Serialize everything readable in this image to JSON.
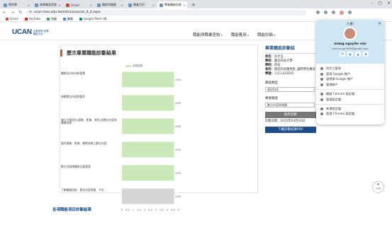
{
  "browser": {
    "tabs": [
      {
        "label": "學習單",
        "active": false
      },
      {
        "label": "搜尋職涯評量",
        "active": false
      },
      {
        "label": "Gmail",
        "active": false
      },
      {
        "label": "職群與職業",
        "active": false
      },
      {
        "label": "職業百科",
        "active": false
      },
      {
        "label": "專業職能診斷",
        "active": true
      }
    ],
    "url": "ucan.moe.edu.tw/mt/ucan/ucan_4_4.aspx",
    "bookmarks": [
      "Gmail",
      "YouTube",
      "地圖",
      "翻譯",
      "Google Meet (視..."
    ]
  },
  "site": {
    "logo": "UCAN",
    "logo_sub": "大專校院 就業職能平台",
    "nav": [
      "職能與職業查詢",
      "職能應用",
      "職能診斷"
    ]
  },
  "main": {
    "card_title": "歷次專業職能診斷結果",
    "legend": "診斷結果",
    "chart_data": {
      "type": "bar",
      "orientation": "horizontal",
      "categories": [
        "職能及分析技術要素",
        "規劃數位內容與製作",
        "進行方案設計(圖像、影像、視訊)及數位內容與基礎技術",
        "製作圖像、影像、動態效果之數位內容",
        "數位內容傳播與品質管理",
        "了解職務技術、數位內容專業、平台"
      ],
      "values": [
        4.6,
        4.6,
        4.6,
        4.6,
        4.6,
        4.6
      ],
      "value_labels": [
        "4.60",
        "4.60",
        "4.60",
        "4.60",
        "4.60",
        "4.60"
      ],
      "xlim": [
        0,
        5
      ],
      "xticks": [
        "0",
        "0.5",
        "1",
        "1.5",
        "2",
        "2.5",
        "3",
        "3.5",
        "4",
        "4.5",
        "5"
      ],
      "colors": [
        "#cbe8b8",
        "#cbe8b8",
        "#cbe8b8",
        "#cbe8b8",
        "#cbe8b8",
        "#d6d6d6"
      ]
    }
  },
  "side": {
    "title": "專業職能診斷結",
    "rows": [
      {
        "key": "姓名：",
        "value": "阮文孟"
      },
      {
        "key": "學校：",
        "value": "醒吾科技大學"
      },
      {
        "key": "學制：",
        "value": "四技"
      },
      {
        "key": "系所：",
        "value": "資訊科技應用系_國際學生專班"
      },
      {
        "key": "學號：",
        "value": "1111310035"
      }
    ],
    "group_label": "職能類型",
    "group_value": "資訊科技",
    "job_label": "專業職能",
    "job_value": "數位內容與傳播",
    "print_button": "既有診斷",
    "date_label": "診斷日期：2025年04月16日",
    "download_button": "下載診斷結果PDF"
  },
  "footer": {
    "section2": "各項職能項目診斷結果",
    "top_label": "TOP"
  },
  "profile_popup": {
    "greeting": "人員!",
    "name": "mừng nguyễn văn",
    "email": "vanmung1995@gmail.com",
    "items": [
      "同步已暫停",
      "管理 Google 帳戶",
      "變更開 Google 帳戶",
      "管理帳戶",
      "開啟 Chrome 設定檔",
      "管理設定檔",
      "新增設定檔",
      "管理 Chrome 設定檔"
    ]
  }
}
